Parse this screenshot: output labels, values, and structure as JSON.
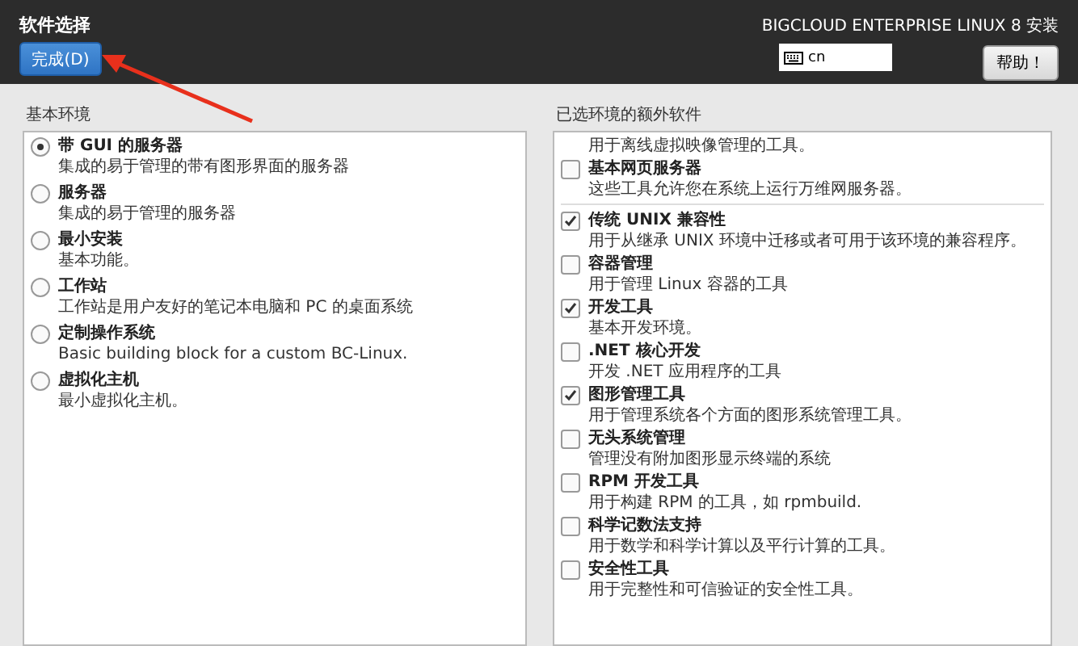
{
  "header": {
    "title": "软件选择",
    "done_button": "完成(D)",
    "product": "BIGCLOUD ENTERPRISE LINUX 8 安装",
    "keyboard": "cn",
    "help_button": "帮助！"
  },
  "base_environment": {
    "label": "基本环境",
    "items": [
      {
        "name": "带 GUI 的服务器",
        "description": "集成的易于管理的带有图形界面的服务器",
        "selected": true
      },
      {
        "name": "服务器",
        "description": "集成的易于管理的服务器",
        "selected": false
      },
      {
        "name": "最小安装",
        "description": "基本功能。",
        "selected": false
      },
      {
        "name": "工作站",
        "description": "工作站是用户友好的笔记本电脑和 PC 的桌面系统",
        "selected": false
      },
      {
        "name": "定制操作系统",
        "description": "Basic building block for a custom BC-Linux.",
        "selected": false
      },
      {
        "name": "虚拟化主机",
        "description": "最小虚拟化主机。",
        "selected": false
      }
    ]
  },
  "addons": {
    "label": "已选环境的额外软件",
    "groups": [
      [
        {
          "description": "用于离线虚拟映像管理的工具。"
        },
        {
          "name": "基本网页服务器",
          "description": "这些工具允许您在系统上运行万维网服务器。",
          "checked": false
        }
      ],
      [
        {
          "name": "传统 UNIX 兼容性",
          "description": "用于从继承 UNIX 环境中迁移或者可用于该环境的兼容程序。",
          "checked": true
        },
        {
          "name": "容器管理",
          "description": "用于管理 Linux 容器的工具",
          "checked": false
        },
        {
          "name": "开发工具",
          "description": "基本开发环境。",
          "checked": true
        },
        {
          "name": ".NET 核心开发",
          "description": "开发 .NET 应用程序的工具",
          "checked": false
        },
        {
          "name": "图形管理工具",
          "description": "用于管理系统各个方面的图形系统管理工具。",
          "checked": true
        },
        {
          "name": "无头系统管理",
          "description": "管理没有附加图形显示终端的系统",
          "checked": false
        },
        {
          "name": "RPM 开发工具",
          "description": "用于构建 RPM 的工具，如 rpmbuild.",
          "checked": false
        },
        {
          "name": "科学记数法支持",
          "description": "用于数学和科学计算以及平行计算的工具。",
          "checked": false
        },
        {
          "name": "安全性工具",
          "description": "用于完整性和可信验证的安全性工具。",
          "checked": false
        }
      ]
    ]
  }
}
